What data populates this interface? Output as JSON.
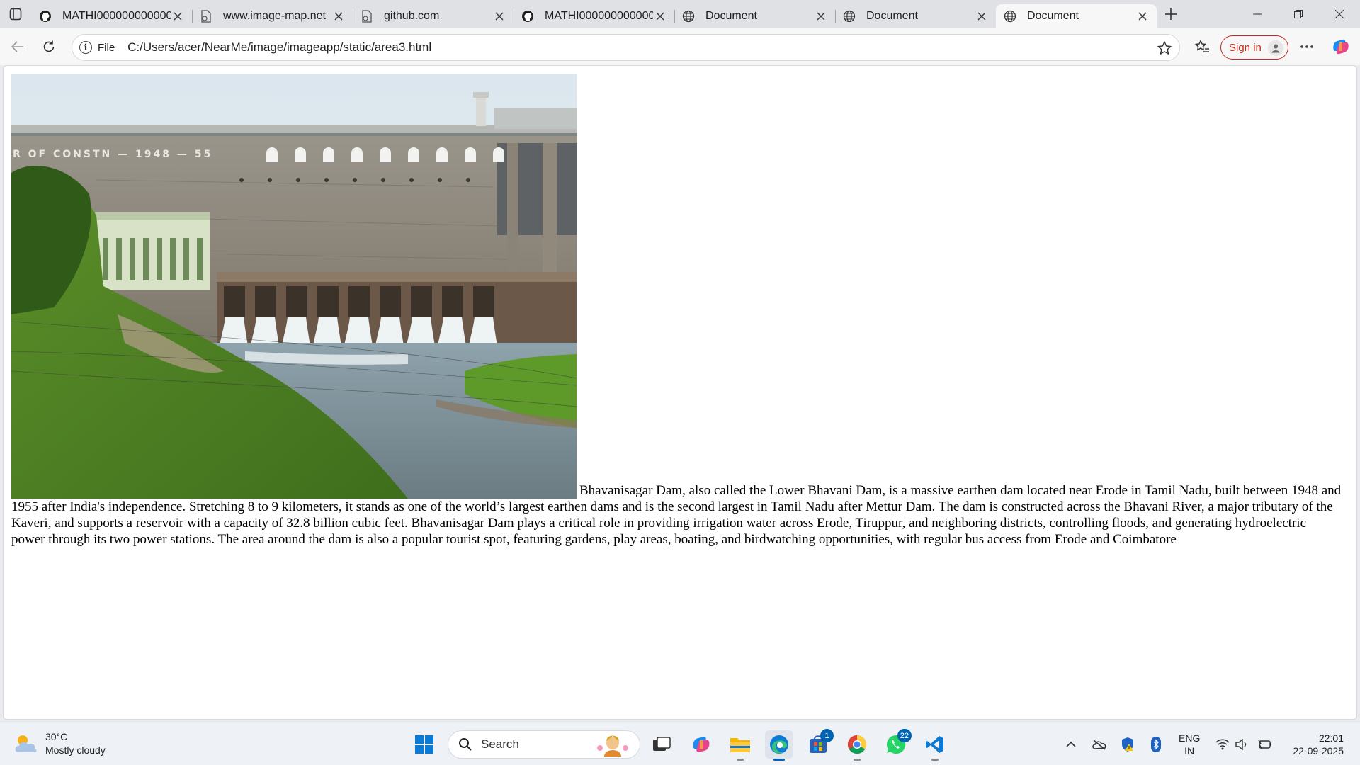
{
  "tabs": [
    {
      "title": "MATHI0000000000000",
      "icon": "github-icon"
    },
    {
      "title": "www.image-map.net",
      "icon": "page-icon"
    },
    {
      "title": "github.com",
      "icon": "page-icon"
    },
    {
      "title": "MATHI0000000000000",
      "icon": "github-icon"
    },
    {
      "title": "Document",
      "icon": "globe-icon"
    },
    {
      "title": "Document",
      "icon": "globe-icon"
    },
    {
      "title": "Document",
      "icon": "globe-icon",
      "active": true
    }
  ],
  "address": {
    "scheme_label": "File",
    "url": "C:/Users/acer/NearMe/image/imageapp/static/area3.html"
  },
  "profile": {
    "signin_label": "Sign in"
  },
  "page": {
    "paragraph": "Bhavanisagar Dam, also called the Lower Bhavani Dam, is a massive earthen dam located near Erode in Tamil Nadu, built between 1948 and 1955 after India's independence. Stretching 8 to 9 kilometers, it stands as one of the world’s largest earthen dams and is the second largest in Tamil Nadu after Mettur Dam. The dam is constructed across the Bhavani River, a major tributary of the Kaveri, and supports a reservoir with a capacity of 32.8 billion cubic feet. Bhavanisagar Dam plays a critical role in providing irrigation water across Erode, Tiruppur, and neighboring districts, controlling floods, and generating hydroelectric power through its two power stations. The area around the dam is also a popular tourist spot, featuring gardens, play areas, boating, and birdwatching opportunities, with regular bus access from Erode and Coimbatore",
    "image_inscription": "R OF CONSTN — 1948 — 55"
  },
  "taskbar": {
    "weather": {
      "temp": "30°C",
      "condition": "Mostly cloudy"
    },
    "search_label": "Search",
    "store_badge": "1",
    "whatsapp_badge": "22",
    "language": {
      "line1": "ENG",
      "line2": "IN"
    },
    "clock": {
      "time": "22:01",
      "date": "22-09-2025"
    }
  },
  "colors": {
    "accent": "#005fb8",
    "signin": "#c42b1c"
  }
}
